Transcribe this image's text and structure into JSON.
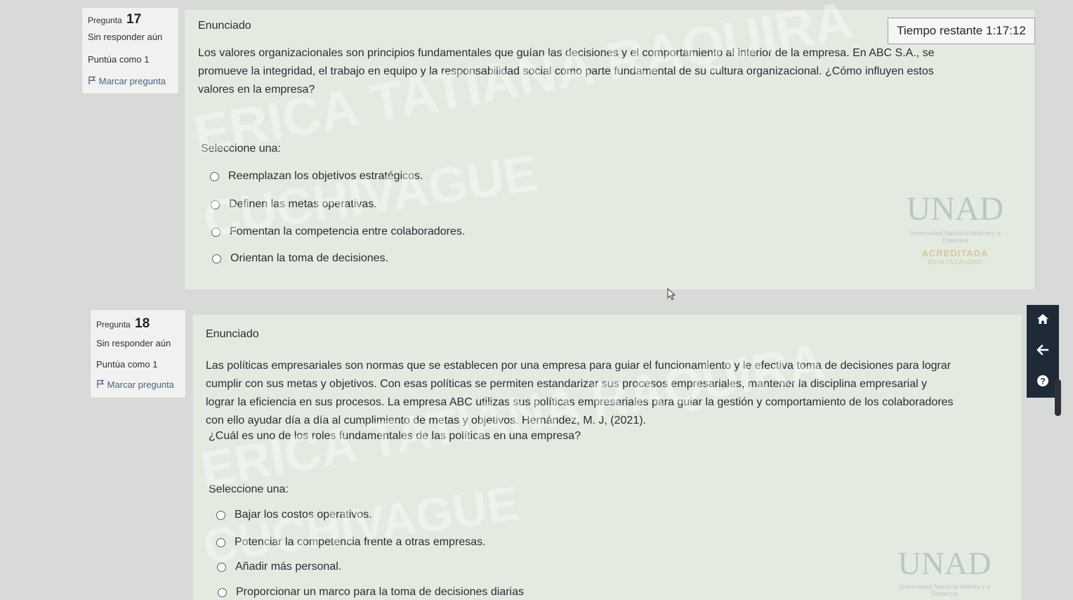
{
  "questions": [
    {
      "label": "Pregunta",
      "number": "17",
      "status": "Sin responder aún",
      "score": "Puntúa como 1",
      "flag_label": "Marcar pregunta",
      "heading": "Enunciado",
      "stem_lines": [
        "Los valores organizacionales son principios fundamentales que guían las decisiones y el comportamiento al interior de la empresa. En ABC S.A., se",
        "promueve la integridad, el trabajo en equipo y la responsabilidad social como parte fundamental de su cultura organizacional. ¿Cómo influyen estos",
        "valores en la empresa?"
      ],
      "prompt": "",
      "select_label": "Seleccione una:",
      "options": [
        "Reemplazan los objetivos estratégicos.",
        "Definen las metas operativas.",
        "Fomentan la competencia entre colaboradores.",
        "Orientan la toma de decisiones."
      ]
    },
    {
      "label": "Pregunta",
      "number": "18",
      "status": "Sin responder aún",
      "score": "Puntúa como 1",
      "flag_label": "Marcar pregunta",
      "heading": "Enunciado",
      "stem_lines": [
        "Las políticas empresariales son normas que se establecen por una empresa para guiar el funcionamiento y le efectiva toma de decisiones para lograr",
        "cumplir con sus metas y objetivos. Con esas políticas se permiten estandarizar sus procesos empresariales, mantener la disciplina empresarial y",
        "lograr la eficiencia en sus procesos. La empresa ABC utilizas sus políticas empresariales para guiar la gestión y comportamiento de los colaboradores",
        "con ello ayudar día a día al cumplimiento de metas y objetivos. Hernández, M. J, (2021)."
      ],
      "prompt": "¿Cuál es uno de los roles fundamentales de las políticas en una empresa?",
      "select_label": "Seleccione una:",
      "options": [
        "Bajar los costos operativos.",
        "Potenciar la competencia frente a otras empresas.",
        "Añadir más personal.",
        "Proporcionar un marco para la toma de decisiones diarias"
      ]
    }
  ],
  "timer": {
    "text": "Tiempo restante 1:17:12"
  },
  "watermark": {
    "line1": "ERICA TATIANA RAQUIRA",
    "line2": "CUCHIVAGUE"
  },
  "logo": {
    "brand": "UNAD",
    "subtitle": "Universidad Nacional Abierta y a Distancia",
    "accreditation": "ACREDITADA",
    "accreditation_sub": "EN ALTA CALIDAD"
  },
  "icons": {
    "home": "home-icon",
    "back": "arrow-left-icon",
    "help": "question-circle-icon",
    "flag": "flag-icon"
  },
  "colors": {
    "nav_button_bg": "#1f2a38",
    "content_bg": "#e3ebe1",
    "info_bg": "#f1f2f0"
  }
}
